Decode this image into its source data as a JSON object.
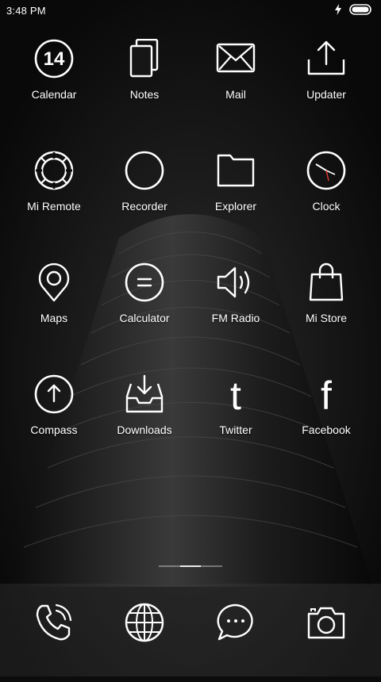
{
  "status_bar": {
    "time": "3:48 PM",
    "icons": [
      "charging-icon",
      "battery-icon"
    ]
  },
  "apps": [
    {
      "label": "Calendar",
      "icon": "calendar-icon",
      "date": "14"
    },
    {
      "label": "Notes",
      "icon": "notes-icon"
    },
    {
      "label": "Mail",
      "icon": "mail-icon"
    },
    {
      "label": "Updater",
      "icon": "updater-icon"
    },
    {
      "label": "Mi Remote",
      "icon": "mi-remote-icon"
    },
    {
      "label": "Recorder",
      "icon": "recorder-icon"
    },
    {
      "label": "Explorer",
      "icon": "folder-icon"
    },
    {
      "label": "Clock",
      "icon": "clock-icon"
    },
    {
      "label": "Maps",
      "icon": "map-pin-icon"
    },
    {
      "label": "Calculator",
      "icon": "calculator-icon"
    },
    {
      "label": "FM Radio",
      "icon": "speaker-icon"
    },
    {
      "label": "Mi Store",
      "icon": "shopping-bag-icon"
    },
    {
      "label": "Compass",
      "icon": "compass-icon"
    },
    {
      "label": "Downloads",
      "icon": "download-tray-icon"
    },
    {
      "label": "Twitter",
      "icon": "twitter-icon",
      "glyph": "t"
    },
    {
      "label": "Facebook",
      "icon": "facebook-icon",
      "glyph": "f"
    }
  ],
  "dock": [
    {
      "icon": "phone-icon"
    },
    {
      "icon": "browser-globe-icon"
    },
    {
      "icon": "messaging-icon"
    },
    {
      "icon": "camera-icon"
    }
  ],
  "page_indicator": {
    "pages": 3,
    "active": 2
  },
  "colors": {
    "icon_stroke": "#ffffff",
    "background": "#0c0c0c"
  }
}
